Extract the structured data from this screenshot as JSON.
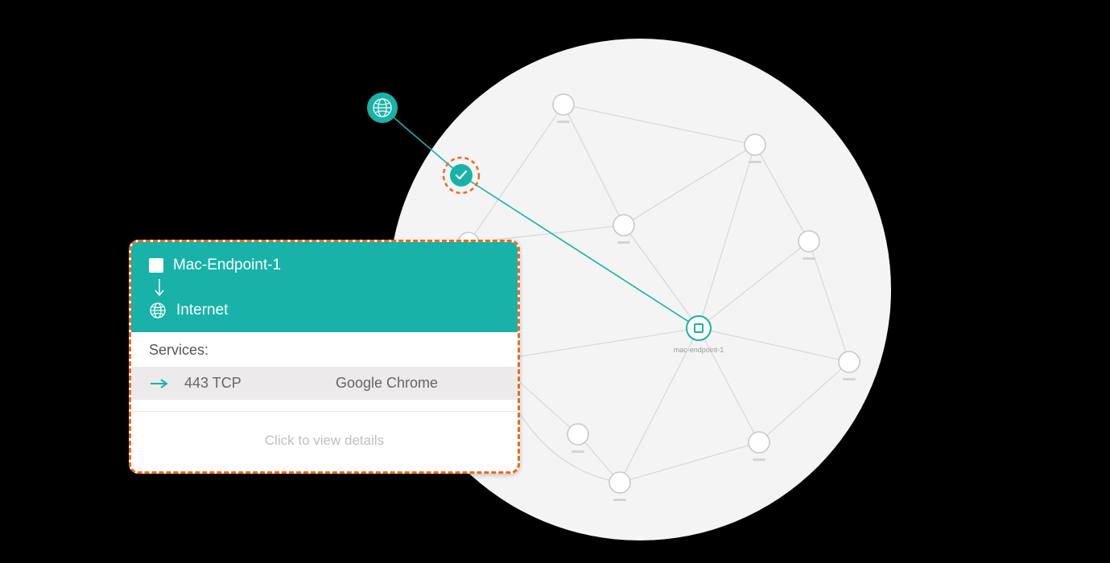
{
  "card": {
    "source_label": "Mac-Endpoint-1",
    "dest_label": "Internet",
    "services_heading": "Services:",
    "service_port": "443 TCP",
    "service_app": "Google Chrome",
    "footer_cta": "Click to view details"
  },
  "graph": {
    "selected_node_label": "mac-endpoint-1",
    "cluster_label": "",
    "internet_node_label": ""
  },
  "colors": {
    "accent": "#18b2a8",
    "highlight_ring": "#ec6a1a",
    "node_stroke": "#c9c9c9",
    "bg_circle": "#f4f4f4"
  }
}
